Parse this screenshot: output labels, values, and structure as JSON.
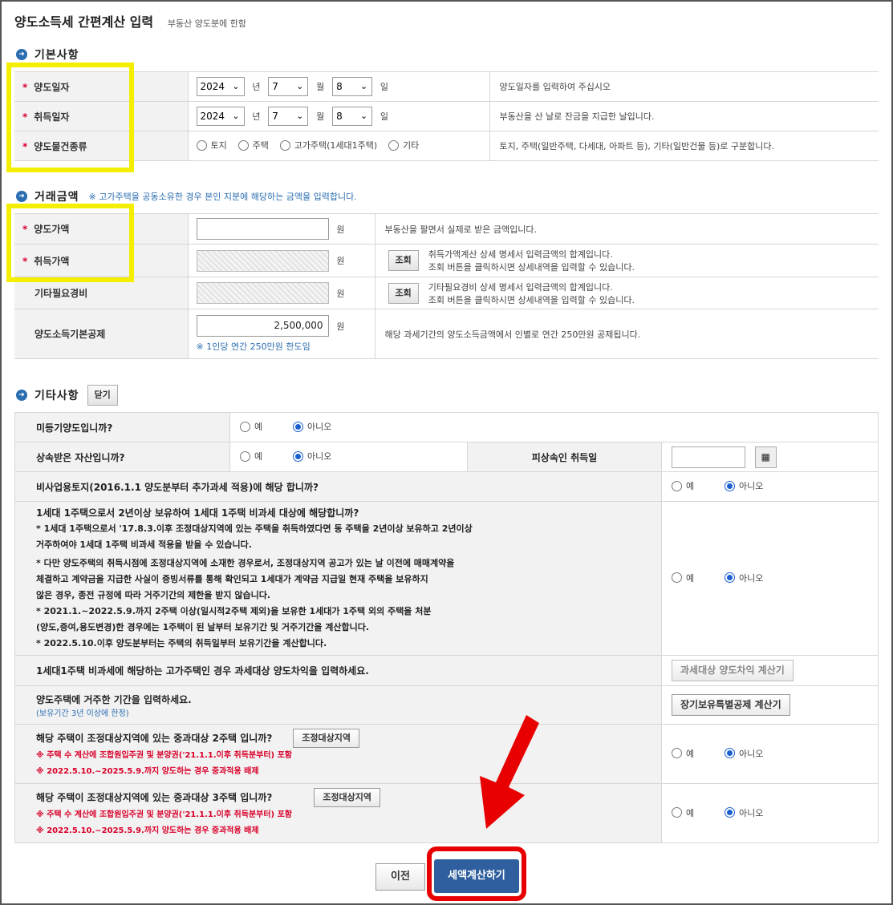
{
  "title": "양도소득세 간편계산 입력",
  "subtitle": "부동산 양도분에 한함",
  "basic": {
    "heading": "기본사항",
    "rows": [
      {
        "label": "양도일자",
        "year": "2024",
        "month": "7",
        "day": "8",
        "year_unit": "년",
        "month_unit": "월",
        "day_unit": "일",
        "desc": "양도일자를 입력하여 주십시오"
      },
      {
        "label": "취득일자",
        "year": "2024",
        "month": "7",
        "day": "8",
        "year_unit": "년",
        "month_unit": "월",
        "day_unit": "일",
        "desc": "부동산을 산 날로 잔금을 지급한 날입니다."
      }
    ],
    "type_row": {
      "label": "양도물건종류",
      "options": [
        "토지",
        "주택",
        "고가주택(1세대1주택)",
        "기타"
      ],
      "desc": "토지, 주택(일반주택, 다세대, 아파트 등), 기타(일반건물 등)로 구분합니다."
    }
  },
  "trade": {
    "heading": "거래금액",
    "note": "※ 고가주택을 공동소유한 경우 본인 지분에 해당하는 금액을 입력합니다.",
    "won": "원",
    "lookup": "조회",
    "sale_label": "양도가액",
    "sale_desc": "부동산을 팔면서 실제로 받은 금액입니다.",
    "acq_label": "취득가액",
    "acq_desc1": "취득가액계산 상세 명세서 입력금액의 합계입니다.",
    "acq_desc2": "조회 버튼을 클릭하시면 상세내역을 입력할 수 있습니다.",
    "etc_label": "기타필요경비",
    "etc_desc1": "기타필요경비 상세 명세서 입력금액의 합계입니다.",
    "etc_desc2": "조회 버튼을 클릭하시면 상세내역을 입력할 수 있습니다.",
    "ded_label": "양도소득기본공제",
    "ded_value": "2,500,000",
    "ded_note": "※ 1인당 연간 250만원 한도임",
    "ded_desc": "해당 과세기간의 양도소득금액에서 인별로 연간 250만원 공제됩니다."
  },
  "etc": {
    "heading": "기타사항",
    "close": "닫기",
    "yes": "예",
    "no": "아니오",
    "q1": "미등기양도입니까?",
    "q2": "상속받은 자산입니까?",
    "q2_extra": "피상속인 취득일",
    "q3": "비사업용토지(2016.1.1 양도분부터 추가과세 적용)에 해당 합니까?",
    "q4_title": "1세대 1주택으로서 2년이상 보유하여 1세대 1주택 비과세 대상에 해당합니까?",
    "q4_l1": "* 1세대 1주택으로서 '17.8.3.이후 조정대상지역에 있는 주택을 취득하였다면 동 주택을 2년이상 보유하고 2년이상",
    "q4_l2": "거주하여야 1세대 1주택 비과세 적용을 받을 수 있습니다.",
    "q4_l3": "* 다만 양도주택의 취득시점에 조정대상지역에 소재한 경우로서, 조정대상지역 공고가 있는 날 이전에 매매계약을",
    "q4_l4": "체결하고 계약금을 지급한 사실이 증빙서류를 통해 확인되고 1세대가 계약금 지급일 현재 주택을 보유하지",
    "q4_l5": "않은 경우, 종전 규정에 따라 거주기간의 제한을 받지 않습니다.",
    "q4_l6": "* 2021.1.~2022.5.9.까지 2주택 이상(일시적2주택 제외)을 보유한 1세대가 1주택 외의 주택을 처분",
    "q4_l7": "(양도,증여,용도변경)한 경우에는 1주택이 된 날부터 보유기간 및 거주기간을 계산합니다.",
    "q4_l8": "* 2022.5.10.이후 양도분부터는 주택의 취득일부터 보유기간을 계산합니다.",
    "q5": "1세대1주택 비과세에 해당하는 고가주택인 경우 과세대상 양도차익을 입력하세요.",
    "q5_btn": "과세대상 양도차익 계산기",
    "q6": "양도주택에 거주한 기간을 입력하세요.",
    "q6_sub": "(보유기간 3년 이상에 한정)",
    "q6_btn": "장기보유특별공제 계산기",
    "q7": "해당 주택이 조정대상지역에 있는 중과대상 2주택 입니까?",
    "q8": "해당 주택이 조정대상지역에 있는 중과대상 3주택 입니까?",
    "zone_btn": "조정대상지역",
    "red1": "※ 주택 수 계산에 조합원입주권 및 분양권('21.1.1.이후 취득분부터) 포함",
    "red2": "※ 2022.5.10.~2025.5.9.까지 양도하는 경우 중과적용 배제"
  },
  "buttons": {
    "prev": "이전",
    "calc": "세액계산하기"
  },
  "colors": {
    "accent": "#2a6db0",
    "highlight": "#f4ee00",
    "alert_red": "#e80000",
    "primary_button": "#2f5f9e"
  },
  "icons": {
    "section": "circle-arrow-icon",
    "calendar": "calendar-icon",
    "pointer": "red-arrow-icon"
  }
}
